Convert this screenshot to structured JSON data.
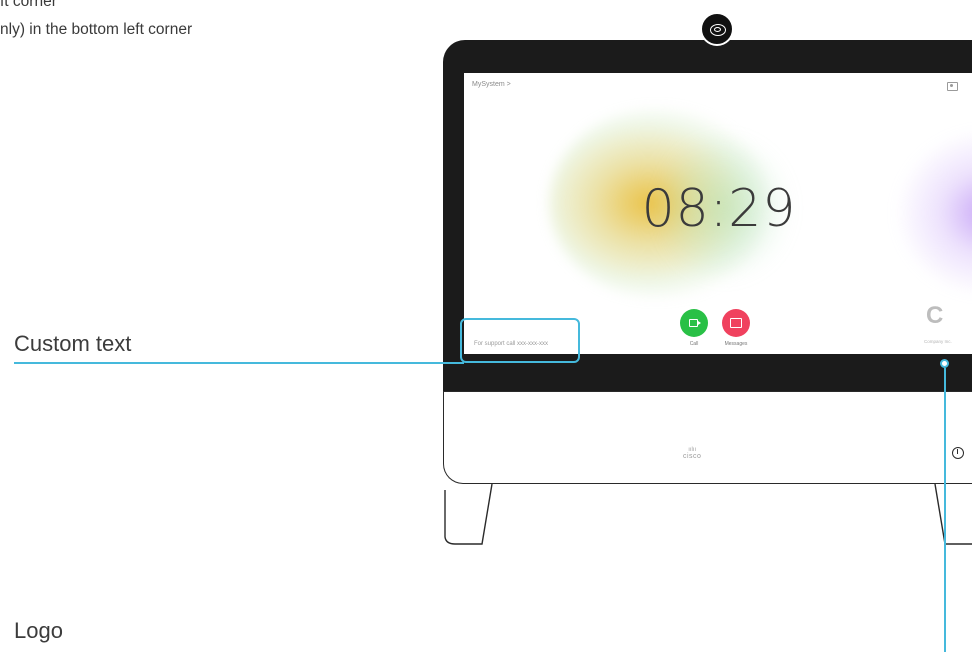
{
  "instructions": {
    "line1": "ft corner",
    "line2": "nly) in the bottom left corner"
  },
  "callouts": {
    "custom_text_label": "Custom text",
    "logo_label": "Logo"
  },
  "screen": {
    "breadcrumb": "MySystem >",
    "clock": "08:29",
    "custom_text": "For support call xxx-xxx-xxx",
    "buttons": [
      {
        "label": "Call",
        "color": "#29c046",
        "icon": "video-camera-icon"
      },
      {
        "label": "Messages",
        "color": "#f0415e",
        "icon": "voicemail-icon"
      }
    ],
    "brand_text": "Company Inc."
  },
  "device": {
    "brand": "cisco",
    "bars": "ıılıı"
  },
  "colors": {
    "highlight": "#45b9dc",
    "bezel": "#1b1b1b"
  }
}
